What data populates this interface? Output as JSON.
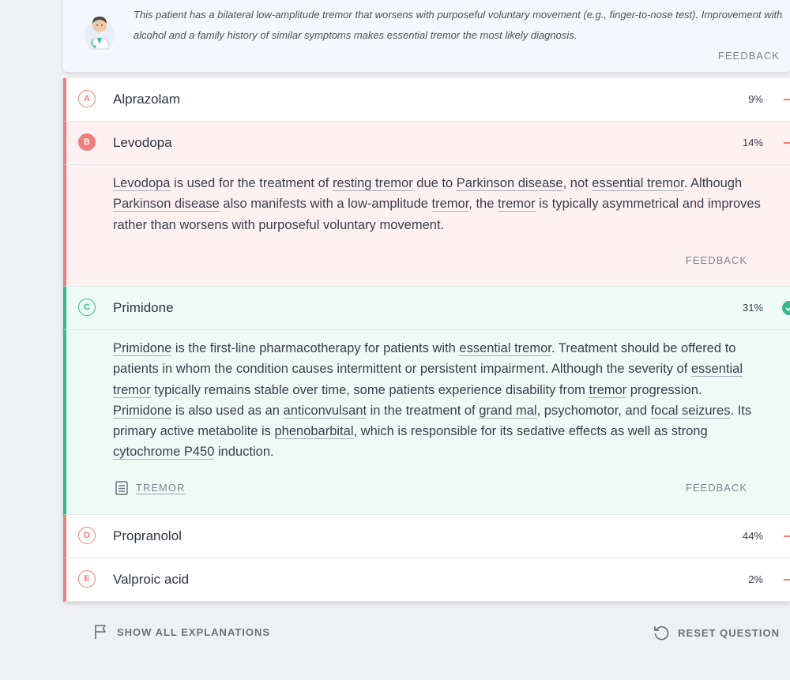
{
  "hint": {
    "text": "This patient has a bilateral low-amplitude tremor that worsens with purposeful voluntary movement (e.g., finger-to-nose test). Improvement with alcohol and a family history of similar symptoms makes essential tremor the most likely diagnosis.",
    "feedback_label": "FEEDBACK",
    "avatar_icon": "doctor-avatar-icon"
  },
  "choices": [
    {
      "letter": "A",
      "label": "Alprazolam",
      "percent": "9%"
    },
    {
      "letter": "B",
      "label": "Levodopa",
      "percent": "14%"
    },
    {
      "letter": "C",
      "label": "Primidone",
      "percent": "31%"
    },
    {
      "letter": "D",
      "label": "Propranolol",
      "percent": "44%"
    },
    {
      "letter": "E",
      "label": "Valproic acid",
      "percent": "2%"
    }
  ],
  "explanation_b": {
    "parts": [
      {
        "t": "Levodopa",
        "link": true
      },
      {
        "t": " is used for the treatment of "
      },
      {
        "t": "resting tremor",
        "link": true
      },
      {
        "t": " due to "
      },
      {
        "t": "Parkinson disease",
        "link": true
      },
      {
        "t": ", not "
      },
      {
        "t": "essential tremor",
        "link": true
      },
      {
        "t": ". Although "
      },
      {
        "t": "Parkinson disease",
        "link": true
      },
      {
        "t": " also manifests with a low-amplitude "
      },
      {
        "t": "tremor",
        "link": true
      },
      {
        "t": ", the "
      },
      {
        "t": "tremor",
        "link": true
      },
      {
        "t": " is typically asymmetrical and improves rather than worsens with purposeful voluntary movement."
      }
    ],
    "feedback_label": "FEEDBACK"
  },
  "explanation_c": {
    "parts": [
      {
        "t": "Primidone",
        "link": true
      },
      {
        "t": " is the first-line pharmacotherapy for patients with "
      },
      {
        "t": "essential tremor",
        "link": true
      },
      {
        "t": ". Treatment should be offered to patients in whom the condition causes intermittent or persistent impairment. Although the severity of "
      },
      {
        "t": "essential tremor",
        "link": true
      },
      {
        "t": " typically remains stable over time, some patients experience disability from "
      },
      {
        "t": "tremor",
        "link": true
      },
      {
        "t": " progression. "
      },
      {
        "t": "Primidone",
        "link": true
      },
      {
        "t": " is also used as an "
      },
      {
        "t": "anticonvulsant",
        "link": true
      },
      {
        "t": " in the treatment of "
      },
      {
        "t": "grand mal",
        "link": true
      },
      {
        "t": ", psychomotor, and "
      },
      {
        "t": "focal seizures",
        "link": true
      },
      {
        "t": ". Its primary active metabolite is "
      },
      {
        "t": "phenobarbital",
        "link": true
      },
      {
        "t": ", which is responsible for its sedative effects as well as strong "
      },
      {
        "t": "cytochrome P450",
        "link": true
      },
      {
        "t": " induction."
      }
    ],
    "article_label": "TREMOR",
    "feedback_label": "FEEDBACK"
  },
  "footer": {
    "show_all_label": "SHOW ALL EXPLANATIONS",
    "reset_label": "RESET QUESTION"
  },
  "colors": {
    "wrong": "#f07c7c",
    "correct": "#2dbd8b",
    "wrong_bg": "#fff0f2",
    "correct_bg": "#eefaf5"
  }
}
